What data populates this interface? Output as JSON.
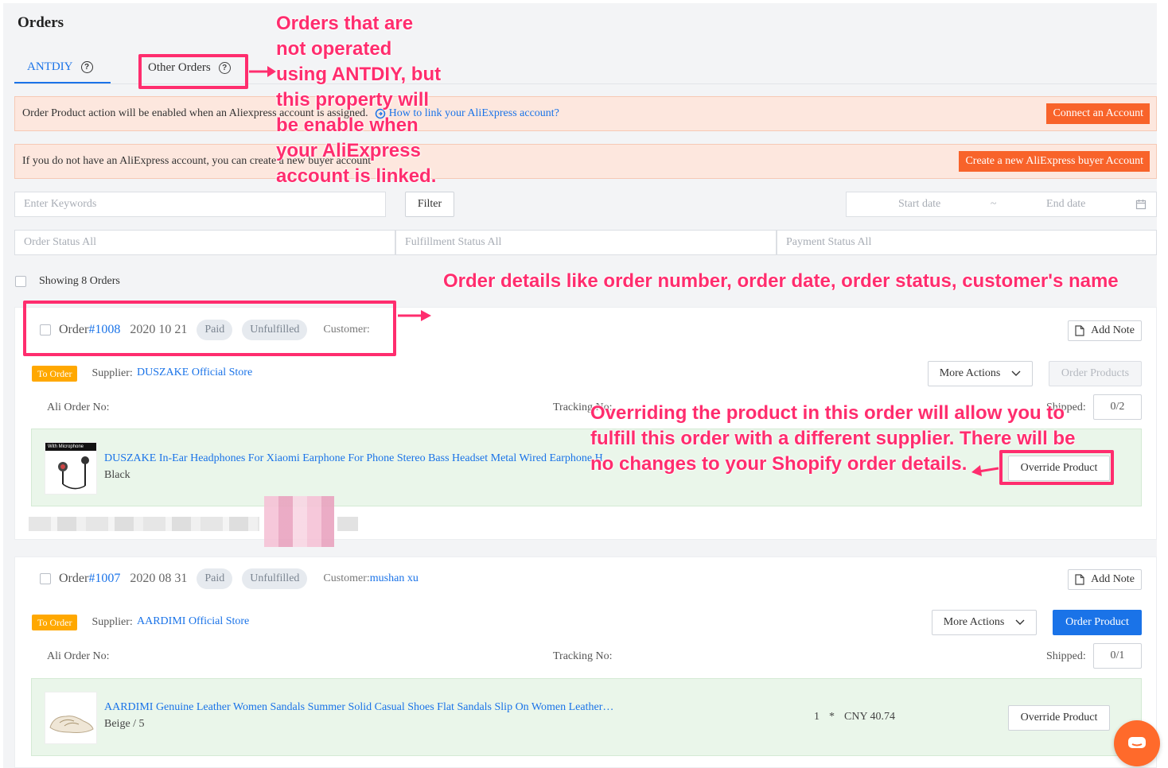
{
  "page": {
    "title": "Orders"
  },
  "tabs": [
    {
      "label": "ANTDIY",
      "active": true
    },
    {
      "label": "Other Orders",
      "active": false
    }
  ],
  "banners": {
    "connect": {
      "text": "Order Product action will be enabled when an Aliexpress account is assigned.",
      "link": "How to link your AliExpress account?",
      "button": "Connect an Account"
    },
    "create": {
      "text": "If you do not have an AliExpress account, you can create a new buyer account",
      "button": "Create a new AliExpress buyer Account"
    }
  },
  "filters": {
    "keyword_placeholder": "Enter Keywords",
    "filter_button": "Filter",
    "start_date": "Start date",
    "date_separator": "~",
    "end_date": "End date",
    "order_status": "Order Status All",
    "fulfillment_status": "Fulfillment Status All",
    "payment_status": "Payment Status All"
  },
  "summary": {
    "showing": "Showing 8 Orders"
  },
  "orders": [
    {
      "order_label": "Order",
      "number": "#1008",
      "date": "2020 10 21",
      "payment": "Paid",
      "fulfillment": "Unfulfilled",
      "customer_label": "Customer:",
      "customer": "",
      "add_note": "Add Note",
      "badge": "To Order",
      "supplier_label": "Supplier:",
      "supplier": "DUSZAKE Official Store",
      "more_actions": "More Actions",
      "order_button": "Order Products",
      "ali_order_label": "Ali Order No:",
      "tracking_label": "Tracking No:",
      "shipped_label": "Shipped:",
      "shipped": "0/2",
      "product": {
        "title": "DUSZAKE In-Ear Headphones For Xiaomi Earphone For Phone Stereo Bass Headset Metal Wired Earphone H",
        "variant": "Black",
        "thumb_text": "With Microphone"
      },
      "override": "Override Product"
    },
    {
      "order_label": "Order",
      "number": "#1007",
      "date": "2020 08 31",
      "payment": "Paid",
      "fulfillment": "Unfulfilled",
      "customer_label": "Customer:",
      "customer": "mushan xu",
      "add_note": "Add Note",
      "badge": "To Order",
      "supplier_label": "Supplier:",
      "supplier": "AARDIMI Official Store",
      "more_actions": "More Actions",
      "order_button": "Order Product",
      "ali_order_label": "Ali Order No:",
      "tracking_label": "Tracking No:",
      "shipped_label": "Shipped:",
      "shipped": "0/1",
      "product": {
        "title": "AARDIMI Genuine Leather Women Sandals Summer Solid Casual Shoes Flat Sandals Slip On Women Leather…",
        "variant": "Beige / 5",
        "quantity": "1",
        "multiply": "*",
        "price": "CNY 40.74"
      },
      "override": "Override Product"
    }
  ],
  "annotations": {
    "other_orders": [
      "Orders that are",
      "not operated",
      "using ANTDIY, but",
      "this property will",
      "be enable when",
      "your AliExpress",
      "account is linked."
    ],
    "order_details": "Order details like order number, order date, order status, customer's name",
    "override": [
      "Overriding the product in this order will allow you to",
      "fulfill this order with a different supplier. There will be",
      "no changes to your Shopify order details."
    ]
  },
  "colors": {
    "accent": "#1a73e8",
    "annotation": "#ff2d6e",
    "banner_bg": "#fde7de",
    "orange_button": "#f8632a",
    "to_order_badge": "#ffa800",
    "product_bg": "#eaf6ea"
  },
  "icons": [
    "help-circle-icon",
    "link-icon",
    "calendar-icon",
    "document-icon",
    "chevron-down-icon",
    "chat-icon"
  ]
}
